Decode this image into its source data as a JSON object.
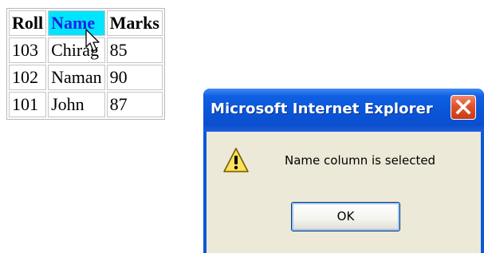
{
  "table": {
    "headers": [
      "Roll",
      "Name",
      "Marks"
    ],
    "selected_header": "Name",
    "rows": [
      [
        "103",
        "Chirag",
        "85"
      ],
      [
        "102",
        "Naman",
        "90"
      ],
      [
        "101",
        "John",
        "87"
      ]
    ]
  },
  "dialog": {
    "title": "Microsoft Internet Explorer",
    "message": "Name column is selected",
    "ok_label": "OK",
    "icon": "warning-icon",
    "close_icon": "close-icon"
  },
  "colors": {
    "selected_header_bg": "#00e5ff",
    "selected_header_text": "#1a22e6",
    "titlebar_blue": "#0a55d6",
    "close_red": "#e2512a",
    "dialog_body": "#ece9d8"
  }
}
